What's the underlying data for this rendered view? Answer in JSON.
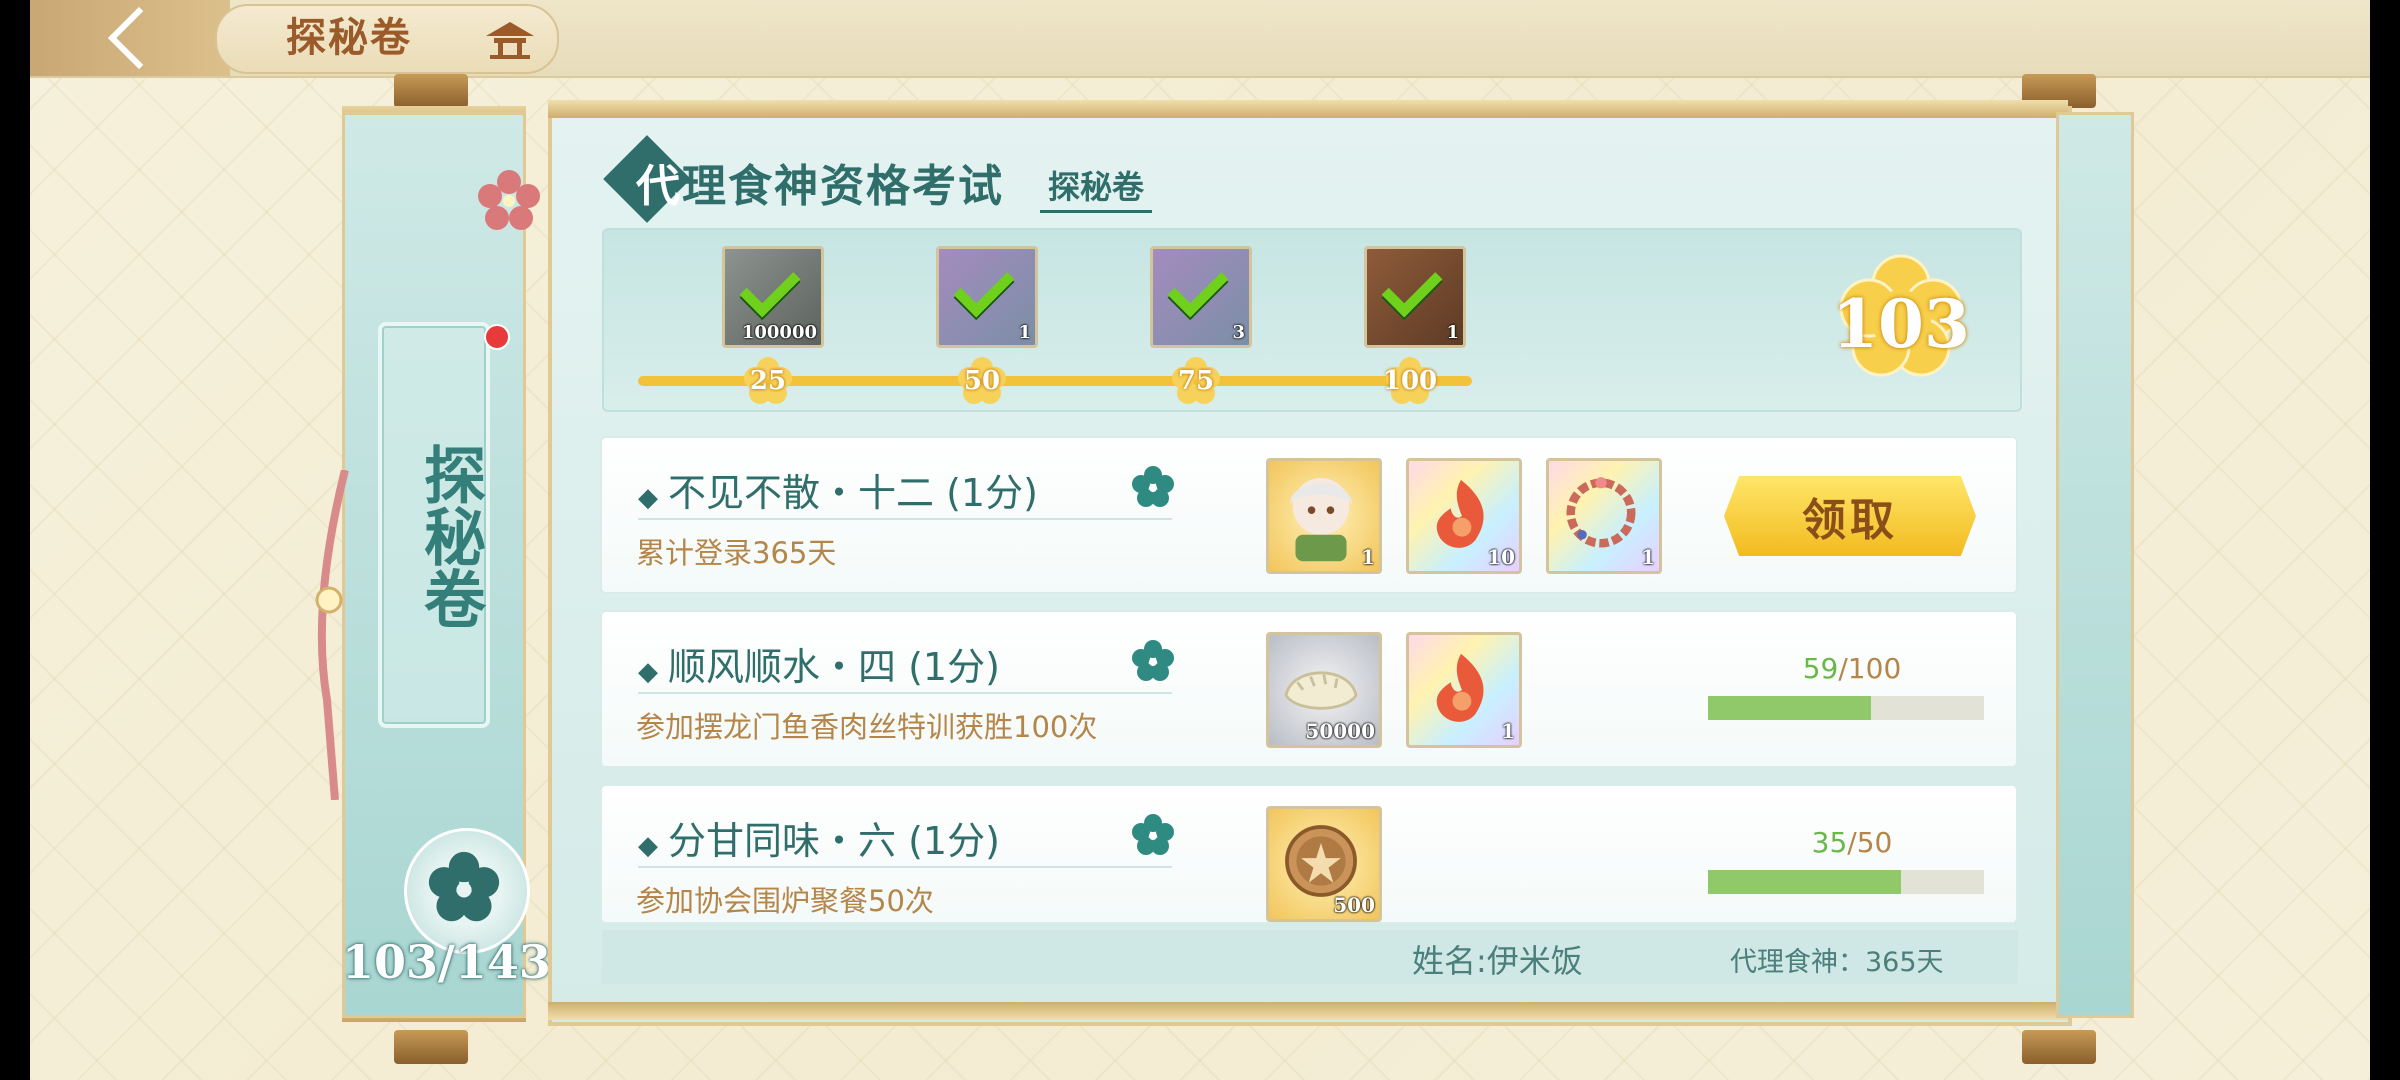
{
  "header": {
    "title": "探秘卷",
    "back_icon": "back-arrow-icon",
    "home_icon": "pavilion-icon"
  },
  "left_panel": {
    "title": "探秘卷",
    "count": "103/143"
  },
  "section": {
    "title_first": "代",
    "title_rest": "理食神资格考试",
    "tab": "探秘卷"
  },
  "milestones": {
    "score": "103",
    "items": [
      {
        "threshold": "25",
        "qty": "100000",
        "color": "gray",
        "claimed": true
      },
      {
        "threshold": "50",
        "qty": "1",
        "color": "purple",
        "claimed": true
      },
      {
        "threshold": "75",
        "qty": "3",
        "color": "purple",
        "claimed": true
      },
      {
        "threshold": "100",
        "qty": "1",
        "color": "brown",
        "claimed": true
      }
    ],
    "progress_fraction": 1.0
  },
  "tasks": [
    {
      "name": "不见不散・十二 (1分)",
      "desc": "累计登录365天",
      "rewards": [
        {
          "qty": "1",
          "style": "gold",
          "icon": "character-portrait-icon"
        },
        {
          "qty": "10",
          "style": "rainbow",
          "icon": "flame-spirit-icon"
        },
        {
          "qty": "1",
          "style": "rainbow",
          "icon": "wreath-icon"
        }
      ],
      "claim_label": "领取"
    },
    {
      "name": "顺风顺水・四 (1分)",
      "desc": "参加摆龙门鱼香肉丝特训获胜100次",
      "rewards": [
        {
          "qty": "50000",
          "style": "silver",
          "icon": "dumpling-coin-icon"
        },
        {
          "qty": "1",
          "style": "rainbow",
          "icon": "flame-spirit-icon"
        }
      ],
      "progress": {
        "current": "59",
        "total": "/100",
        "fraction": 0.59
      }
    },
    {
      "name": "分甘同味・六 (1分)",
      "desc": "参加协会围炉聚餐50次",
      "rewards": [
        {
          "qty": "500",
          "style": "gold",
          "icon": "medal-coin-icon"
        }
      ],
      "progress": {
        "current": "35",
        "total": "/50",
        "fraction": 0.7
      }
    }
  ],
  "footer": {
    "name": "姓名:伊米饭",
    "days": "代理食神：365天"
  },
  "colors": {
    "teal": "#2f6e6a",
    "gold": "#f2c23a",
    "progress_green": "#8fc96a",
    "desc_brown": "#b4864a"
  }
}
